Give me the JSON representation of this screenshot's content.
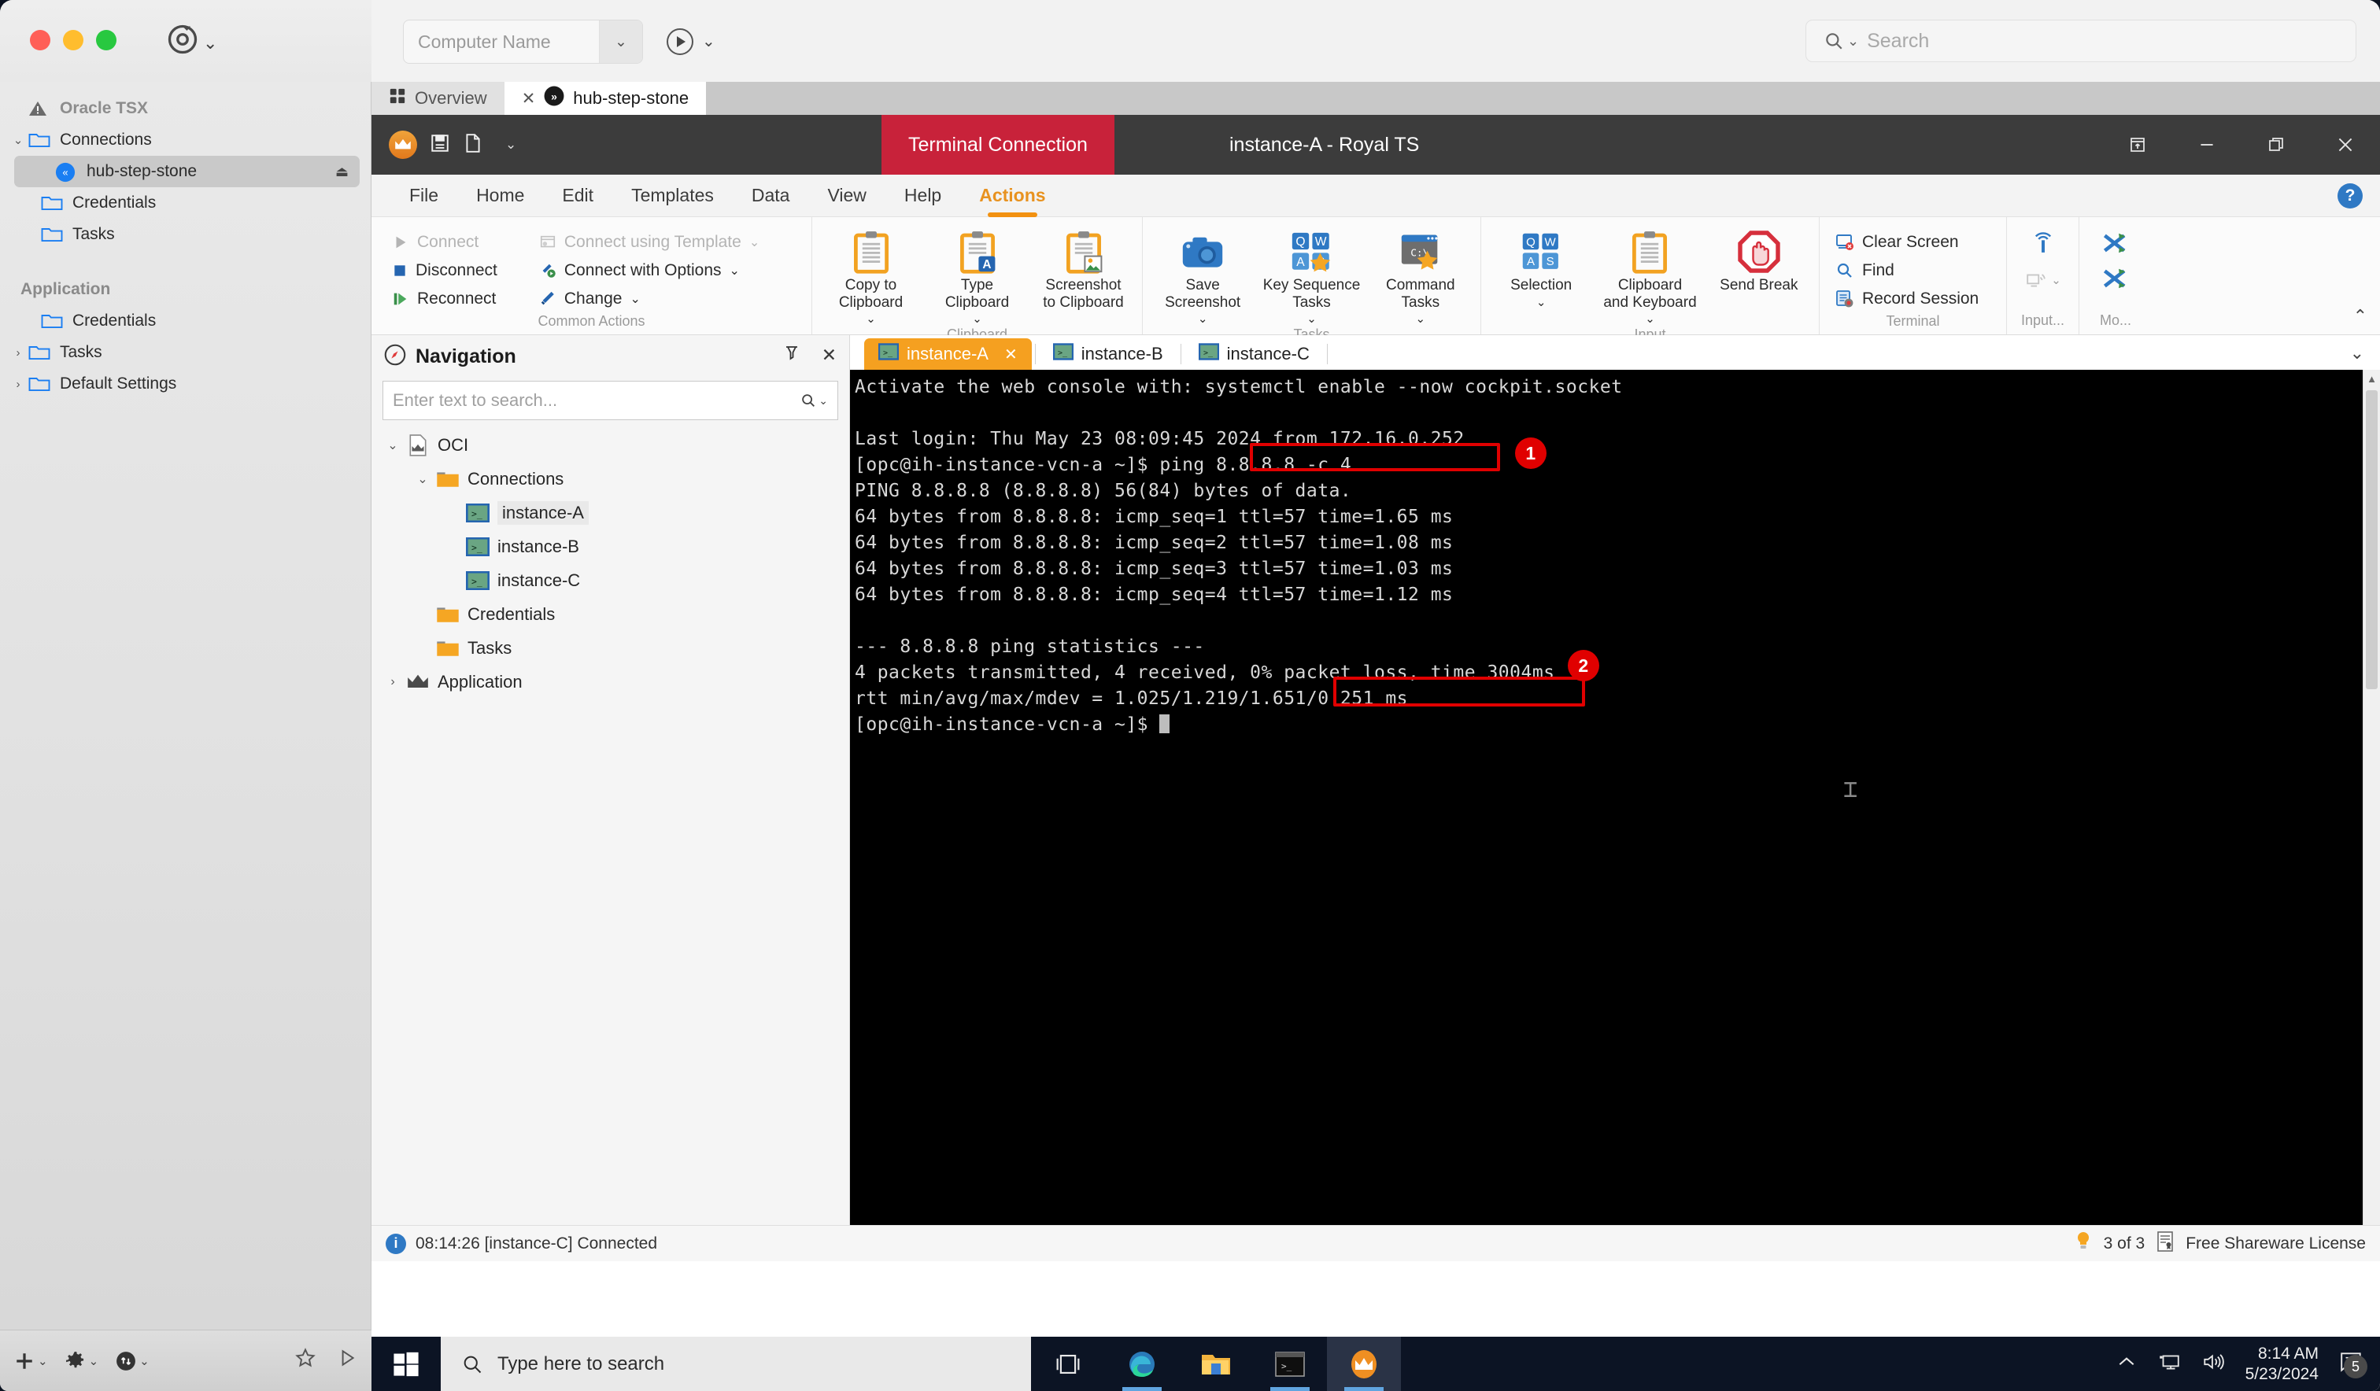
{
  "mac": {
    "target_icon": "target-reload-icon",
    "sidebar": {
      "root_label": "Oracle TSX",
      "groups": [
        {
          "title": "",
          "items": [
            {
              "label": "Connections",
              "icon": "folder-icon",
              "caret": "chevron-down-icon",
              "indent": 1
            },
            {
              "label": "hub-step-stone",
              "icon": "remote-desktop-icon",
              "indent": 2,
              "selected": true,
              "trailing": "eject-icon"
            },
            {
              "label": "Credentials",
              "icon": "folder-icon",
              "indent": 2
            },
            {
              "label": "Tasks",
              "icon": "folder-icon",
              "indent": 2
            }
          ]
        },
        {
          "title": "Application",
          "items": [
            {
              "label": "Credentials",
              "icon": "folder-icon",
              "indent": 2
            },
            {
              "label": "Tasks",
              "icon": "folder-icon",
              "caret": "chevron-right-icon",
              "indent": 1
            },
            {
              "label": "Default Settings",
              "icon": "folder-icon",
              "caret": "chevron-right-icon",
              "indent": 1
            }
          ]
        }
      ]
    },
    "bottom_toolbar": {
      "add": "+",
      "settings": "gear-icon",
      "transfer": "up-down-arrows-icon",
      "favorite": "star-icon",
      "play": "play-icon"
    }
  },
  "rdp": {
    "computer_name_placeholder": "Computer Name",
    "search_placeholder": "Search",
    "tabs": [
      {
        "label": "Overview",
        "icon": "grid-icon",
        "active": false,
        "closable": false
      },
      {
        "label": "hub-step-stone",
        "icon": "royalts-x-icon",
        "active": true,
        "closable": true
      }
    ]
  },
  "royalts": {
    "context_tab": "Terminal Connection",
    "document_title": "instance-A - Royal TS",
    "window_controls": [
      "restore-up-icon",
      "minimize-icon",
      "maximize-icon",
      "close-icon"
    ],
    "quick_access": [
      "crown-icon",
      "save-icon",
      "new-document-icon",
      "customize-caret-icon"
    ],
    "menu": [
      {
        "label": "File",
        "active": false
      },
      {
        "label": "Home",
        "active": false
      },
      {
        "label": "Edit",
        "active": false
      },
      {
        "label": "Templates",
        "active": false
      },
      {
        "label": "Data",
        "active": false
      },
      {
        "label": "View",
        "active": false
      },
      {
        "label": "Help",
        "active": false
      },
      {
        "label": "Actions",
        "active": true
      }
    ],
    "help_badge": "?",
    "ribbon": {
      "groups": [
        {
          "name": "Common Actions",
          "type": "small-two-col",
          "columns": [
            [
              {
                "label": "Connect",
                "icon": "play-triangle-icon",
                "disabled": true
              },
              {
                "label": "Disconnect",
                "icon": "stop-square-icon",
                "disabled": false
              },
              {
                "label": "Reconnect",
                "icon": "reconnect-icon",
                "disabled": false
              }
            ],
            [
              {
                "label": "Connect using Template",
                "icon": "template-icon",
                "disabled": true,
                "caret": true
              },
              {
                "label": "Connect with Options",
                "icon": "wrench-play-icon",
                "disabled": false,
                "caret": true
              },
              {
                "label": "Change",
                "icon": "wrench-icon",
                "disabled": false,
                "caret": true
              }
            ]
          ]
        },
        {
          "name": "Clipboard",
          "type": "big",
          "buttons": [
            {
              "label": "Copy to\nClipboard",
              "icon": "clipboard-icon",
              "caret": true
            },
            {
              "label": "Type\nClipboard",
              "icon": "clipboard-type-icon",
              "caret": true
            },
            {
              "label": "Screenshot\nto Clipboard",
              "icon": "clipboard-image-icon",
              "caret": false
            }
          ]
        },
        {
          "name": "Tasks",
          "type": "big",
          "buttons": [
            {
              "label": "Save\nScreenshot",
              "icon": "camera-icon",
              "caret": true
            },
            {
              "label": "Key Sequence\nTasks",
              "icon": "keys-star-icon",
              "caret": true
            },
            {
              "label": "Command\nTasks",
              "icon": "console-star-icon",
              "caret": true
            }
          ]
        },
        {
          "name": "Input",
          "type": "big",
          "buttons": [
            {
              "label": "Selection",
              "icon": "keys-icon",
              "caret": true
            },
            {
              "label": "Clipboard\nand Keyboard",
              "icon": "clipboard-icon",
              "caret": true
            },
            {
              "label": "Send Break",
              "icon": "stop-hand-icon",
              "caret": false
            }
          ]
        },
        {
          "name": "Terminal",
          "type": "small-one-col",
          "items": [
            {
              "label": "Clear Screen",
              "icon": "clear-screen-icon"
            },
            {
              "label": "Find",
              "icon": "magnifier-icon"
            },
            {
              "label": "Record Session",
              "icon": "record-session-icon"
            }
          ]
        },
        {
          "name": "Input...",
          "type": "icons",
          "icons": [
            "broadcast-input-icon",
            "broadcast-screen-icon"
          ]
        },
        {
          "name": "Mo...",
          "type": "icons",
          "icons": [
            "shuffle-icon",
            "shuffle-icon-2"
          ]
        }
      ],
      "collapse": "chevron-up-icon"
    },
    "navigation": {
      "title": "Navigation",
      "icon": "compass-icon",
      "header_icons": [
        "auto-hide-pin-icon",
        "close-icon"
      ],
      "search_placeholder": "Enter text to search...",
      "search_icon": "magnifier-dropdown-icon",
      "tree": [
        {
          "label": "OCI",
          "icon": "document-crown-icon",
          "caret": "chevron-down-icon",
          "indent": 0
        },
        {
          "label": "Connections",
          "icon": "folder-icon",
          "caret": "chevron-down-icon",
          "indent": 1
        },
        {
          "label": "instance-A",
          "icon": "terminal-icon",
          "indent": 2,
          "selected": true
        },
        {
          "label": "instance-B",
          "icon": "terminal-icon",
          "indent": 2
        },
        {
          "label": "instance-C",
          "icon": "terminal-icon",
          "indent": 2
        },
        {
          "label": "Credentials",
          "icon": "folder-icon",
          "indent": 1
        },
        {
          "label": "Tasks",
          "icon": "folder-icon",
          "indent": 1
        },
        {
          "label": "Application",
          "icon": "crown-icon",
          "caret": "chevron-right-icon",
          "indent": 0
        }
      ]
    },
    "terminal_tabs": [
      {
        "label": "instance-A",
        "icon": "terminal-icon",
        "active": true,
        "closable": true
      },
      {
        "label": "instance-B",
        "icon": "terminal-icon",
        "active": false,
        "closable": false
      },
      {
        "label": "instance-C",
        "icon": "terminal-icon",
        "active": false,
        "closable": false
      }
    ],
    "terminal": {
      "lines": [
        "Activate the web console with: systemctl enable --now cockpit.socket",
        "",
        "Last login: Thu May 23 08:09:45 2024 from 172.16.0.252",
        "[opc@ih-instance-vcn-a ~]$ ping 8.8.8.8 -c 4",
        "PING 8.8.8.8 (8.8.8.8) 56(84) bytes of data.",
        "64 bytes from 8.8.8.8: icmp_seq=1 ttl=57 time=1.65 ms",
        "64 bytes from 8.8.8.8: icmp_seq=2 ttl=57 time=1.08 ms",
        "64 bytes from 8.8.8.8: icmp_seq=3 ttl=57 time=1.03 ms",
        "64 bytes from 8.8.8.8: icmp_seq=4 ttl=57 time=1.12 ms",
        "",
        "--- 8.8.8.8 ping statistics ---",
        "4 packets transmitted, 4 received, 0% packet loss, time 3004ms",
        "rtt min/avg/max/mdev = 1.025/1.219/1.651/0.251 ms",
        "[opc@ih-instance-vcn-a ~]$ "
      ],
      "annotations": [
        {
          "number": "1",
          "target_text": "ping 8.8.8.8 -c 4"
        },
        {
          "number": "2",
          "target_text": "0% packet loss,"
        }
      ],
      "highlight_color": "#e00000"
    },
    "status_bar": {
      "message": "08:14:26 [instance-C] Connected",
      "info_icon": "info-icon",
      "connections_count": "3 of 3",
      "connections_icon": "lightbulb-icon",
      "license": "Free Shareware License",
      "license_icon": "certificate-icon"
    }
  },
  "windows_taskbar": {
    "start_icon": "windows-logo-icon",
    "search_placeholder": "Type here to search",
    "search_icon": "magnifier-icon",
    "items": [
      {
        "name": "task-view-icon",
        "running": false
      },
      {
        "name": "edge-browser-icon",
        "running": true
      },
      {
        "name": "file-explorer-icon",
        "running": false
      },
      {
        "name": "terminal-icon",
        "running": true
      },
      {
        "name": "royalts-icon",
        "running": true,
        "active": true
      }
    ],
    "tray": {
      "chevron": "chevron-up-icon",
      "network_icon": "network-icon",
      "volume_icon": "volume-icon",
      "time": "8:14 AM",
      "date": "5/23/2024",
      "notification_icon": "notification-icon",
      "notification_count": "5"
    }
  },
  "colors": {
    "royal_red": "#c8223a",
    "royal_orange": "#f5a020",
    "accent_blue": "#2f79c4",
    "annotation_red": "#e00000",
    "terminal_bg": "#000000"
  }
}
